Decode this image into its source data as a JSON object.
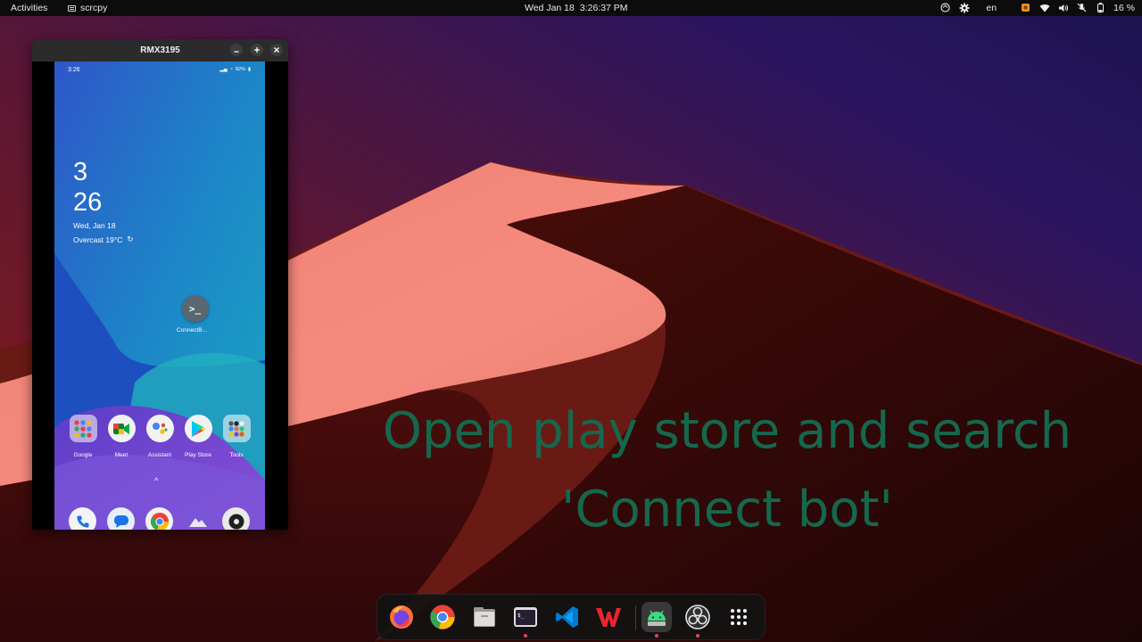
{
  "topbar": {
    "activities": "Activities",
    "app_name": "scrcpy",
    "date": "Wed Jan 18",
    "time": "3:26:37 PM",
    "language": "en",
    "battery": "16 %"
  },
  "scrcpy_window": {
    "title": "RMX3195",
    "minimize": "–",
    "maximize": "+",
    "close": "×"
  },
  "phone": {
    "status_time": "3:26",
    "status_battery": "82%",
    "clock_hour": "3",
    "clock_minute": "26",
    "date": "Wed, Jan 18",
    "weather": "Overcast  19°C",
    "shortcut_label": "ConnectB...",
    "apps": [
      {
        "label": "Google"
      },
      {
        "label": "Meet"
      },
      {
        "label": "Assistant"
      },
      {
        "label": "Play Store"
      },
      {
        "label": "Tools"
      }
    ]
  },
  "caption": {
    "line1": "Open play store and search",
    "line2": "'Connect bot'"
  },
  "dock": {
    "items": [
      "firefox-icon",
      "chrome-icon",
      "files-icon",
      "terminal-icon",
      "vscode-icon",
      "wps-office-icon",
      "android-studio-icon",
      "obs-icon",
      "app-grid-icon"
    ]
  }
}
